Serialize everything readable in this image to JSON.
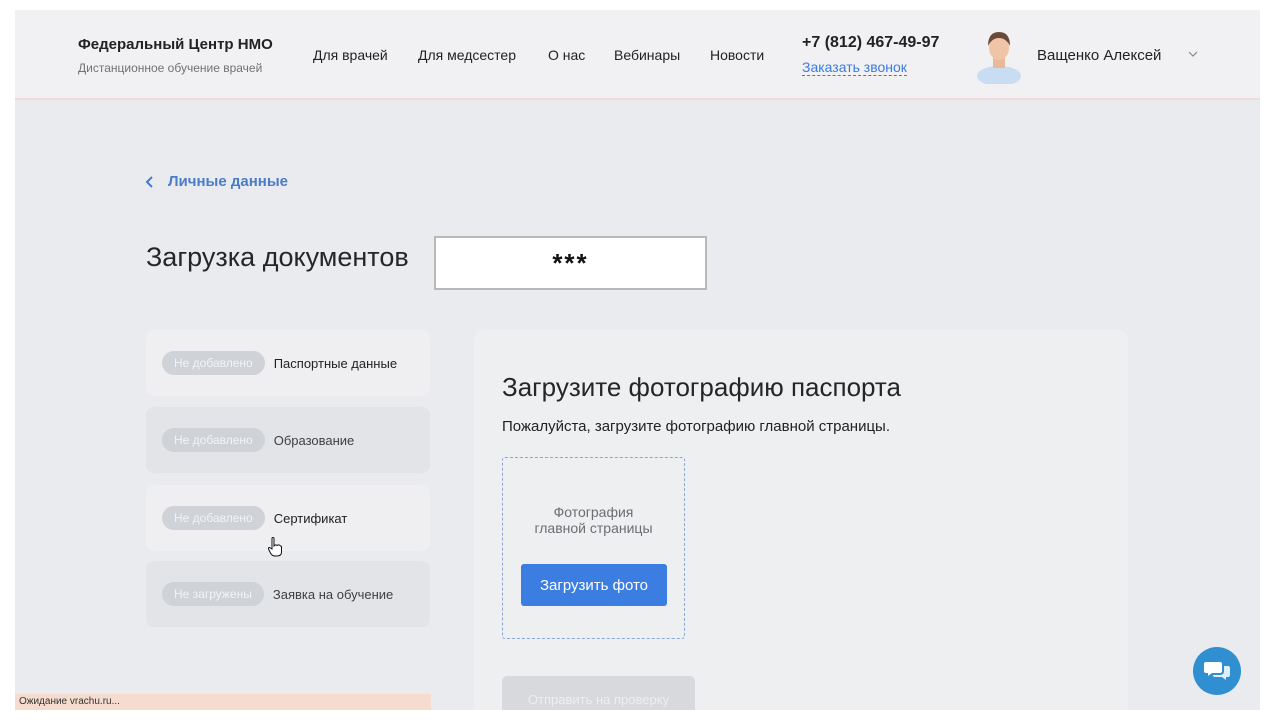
{
  "header": {
    "brand_title": "Федеральный Центр НМО",
    "brand_subtitle": "Дистанционное обучение врачей",
    "nav": [
      {
        "label": "Для врачей"
      },
      {
        "label": "Для медсестер"
      },
      {
        "label": "О нас"
      },
      {
        "label": "Вебинары"
      },
      {
        "label": "Новости"
      }
    ],
    "phone": "+7 (812) 467-49-97",
    "callback_label": "Заказать звонок",
    "user_name": "Ващенко Алексей",
    "icons": {
      "avatar": "user-avatar",
      "chevron": "chevron-down-icon"
    }
  },
  "breadcrumb": {
    "back_label": "Личные данные",
    "icon": "chevron-left-icon"
  },
  "page": {
    "title": "Загрузка документов",
    "redaction_text": "***"
  },
  "sidebar": {
    "items": [
      {
        "status": "Не добавлено",
        "label": "Паспортные данные"
      },
      {
        "status": "Не добавлено",
        "label": "Образование"
      },
      {
        "status": "Не добавлено",
        "label": "Сертификат"
      },
      {
        "status": "Не загружены",
        "label": "Заявка на обучение"
      }
    ]
  },
  "panel": {
    "title": "Загрузите фотографию паспорта",
    "description": "Пожалуйста, загрузите фотографию главной страницы.",
    "upload_caption": "Фотография главной страницы",
    "upload_button": "Загрузить фото",
    "submit_button": "Отправить на проверку"
  },
  "status_bar": {
    "text": "Ожидание vrachu.ru..."
  },
  "colors": {
    "accent": "#3b7de0",
    "link": "#4a7cc8",
    "page_bg": "#e9ebef",
    "chat": "#2f8fd0"
  }
}
